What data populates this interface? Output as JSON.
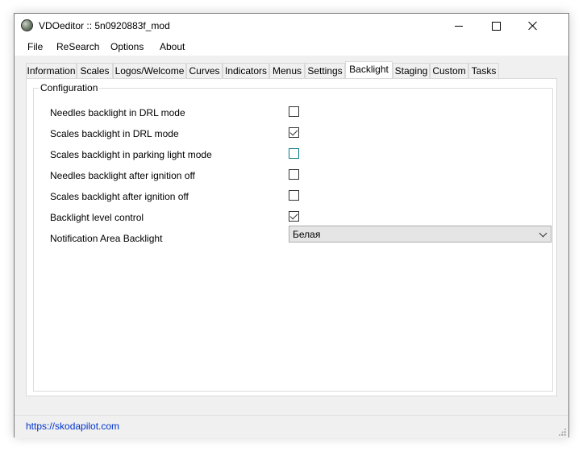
{
  "window": {
    "title": "VDOeditor :: 5n0920883f_mod"
  },
  "menu": [
    "File",
    "ReSearch",
    "Options",
    "About"
  ],
  "tabs": [
    {
      "label": "Information",
      "active": false
    },
    {
      "label": "Scales",
      "active": false
    },
    {
      "label": "Logos/Welcome",
      "active": false
    },
    {
      "label": "Curves",
      "active": false
    },
    {
      "label": "Indicators",
      "active": false
    },
    {
      "label": "Menus",
      "active": false
    },
    {
      "label": "Settings",
      "active": false
    },
    {
      "label": "Backlight",
      "active": true
    },
    {
      "label": "Staging",
      "active": false
    },
    {
      "label": "Custom",
      "active": false
    },
    {
      "label": "Tasks",
      "active": false
    }
  ],
  "config": {
    "legend": "Configuration",
    "options": [
      {
        "label": "Needles backlight in DRL mode",
        "checked": false
      },
      {
        "label": "Scales backlight in DRL mode",
        "checked": true
      },
      {
        "label": "Scales backlight in parking light mode",
        "checked": false
      },
      {
        "label": "Needles backlight after ignition off",
        "checked": false
      },
      {
        "label": "Scales backlight after ignition off",
        "checked": false
      },
      {
        "label": "Backlight level control",
        "checked": true
      }
    ],
    "notification": {
      "label": "Notification Area Backlight",
      "value": "Белая"
    }
  },
  "status": {
    "link": "https://skodapilot.com"
  },
  "colors": {
    "focus_border": "#0a7b83",
    "link": "#0033cc"
  }
}
